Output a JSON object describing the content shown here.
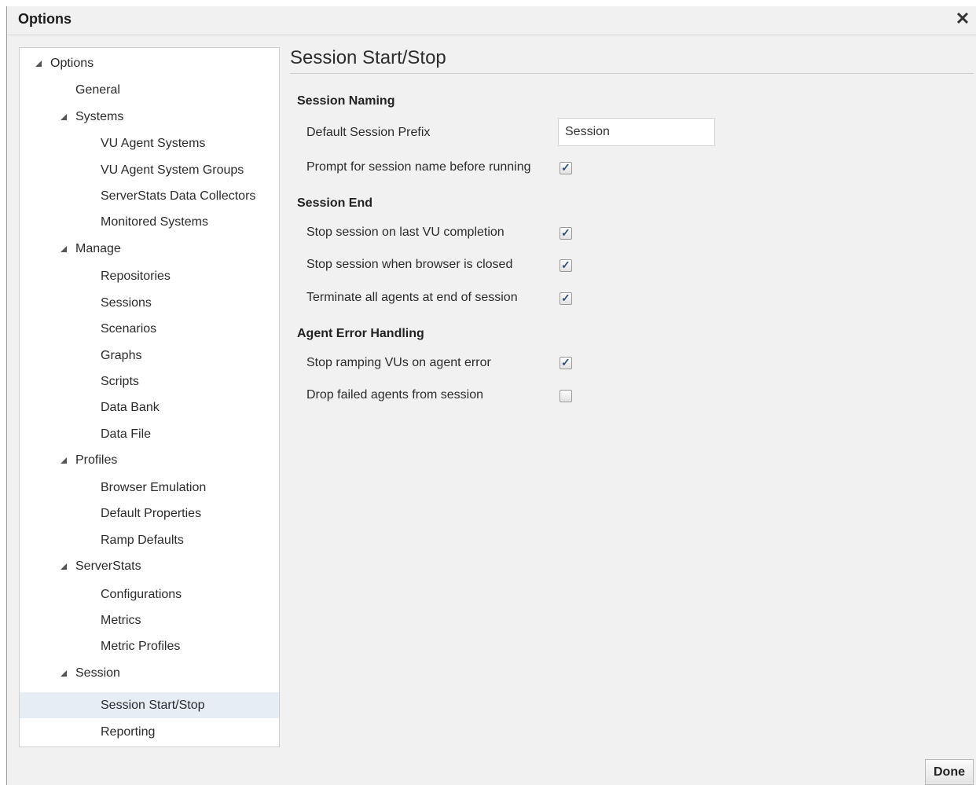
{
  "dialog": {
    "title": "Options"
  },
  "tree": {
    "root": "Options",
    "general": "General",
    "systems": {
      "label": "Systems",
      "items": [
        "VU Agent Systems",
        "VU Agent System Groups",
        "ServerStats Data Collectors",
        "Monitored Systems"
      ]
    },
    "manage": {
      "label": "Manage",
      "items": [
        "Repositories",
        "Sessions",
        "Scenarios",
        "Graphs",
        "Scripts",
        "Data Bank",
        "Data File"
      ]
    },
    "profiles": {
      "label": "Profiles",
      "items": [
        "Browser Emulation",
        "Default Properties",
        "Ramp Defaults"
      ]
    },
    "serverstats": {
      "label": "ServerStats",
      "items": [
        "Configurations",
        "Metrics",
        "Metric Profiles"
      ]
    },
    "session": {
      "label": "Session",
      "items": [
        "Session Start/Stop",
        "Reporting"
      ]
    },
    "selected": "Session Start/Stop"
  },
  "content": {
    "title": "Session Start/Stop",
    "naming": {
      "heading": "Session Naming",
      "prefix_label": "Default Session Prefix",
      "prefix_value": "Session",
      "prompt_label": "Prompt for session name before running",
      "prompt_checked": true
    },
    "end": {
      "heading": "Session End",
      "rows": [
        {
          "label": "Stop session on last VU completion",
          "checked": true
        },
        {
          "label": "Stop session when browser is closed",
          "checked": true
        },
        {
          "label": "Terminate all agents at end of session",
          "checked": true
        }
      ]
    },
    "errors": {
      "heading": "Agent Error Handling",
      "rows": [
        {
          "label": "Stop ramping VUs on agent error",
          "checked": true
        },
        {
          "label": "Drop failed agents from session",
          "checked": false
        }
      ]
    }
  },
  "footer": {
    "done_label": "Done"
  }
}
